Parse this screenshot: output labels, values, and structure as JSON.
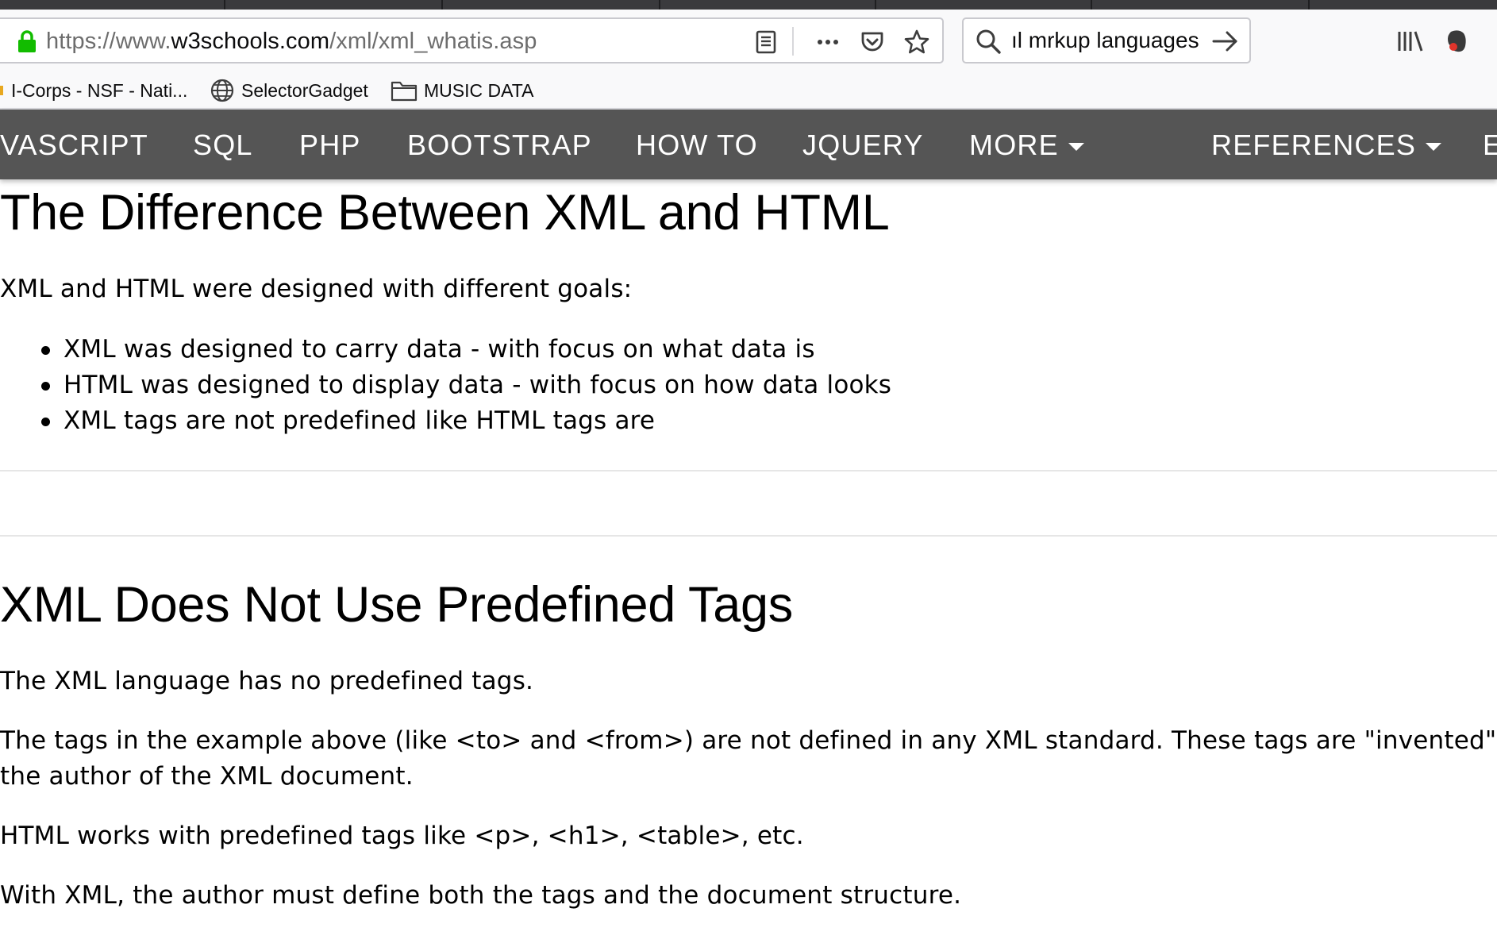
{
  "browser": {
    "url_prefix": "https://www.",
    "url_host": "w3schools.com",
    "url_path": "/xml/xml_whatis.asp",
    "search_text": "ıl mrkup languages",
    "bookmarks": [
      {
        "label": "I-Corps - NSF - Nati...",
        "icon": "bookmark-favicon"
      },
      {
        "label": "SelectorGadget",
        "icon": "globe-icon"
      },
      {
        "label": "MUSIC DATA",
        "icon": "folder-icon"
      }
    ]
  },
  "site_nav": {
    "items": [
      "VASCRIPT",
      "SQL",
      "PHP",
      "BOOTSTRAP",
      "HOW TO",
      "JQUERY",
      "MORE",
      "REFERENCES",
      "E"
    ],
    "bg_color": "#555555"
  },
  "section1": {
    "heading": "The Difference Between XML and HTML",
    "intro": "XML and HTML were designed with different goals:",
    "bullets": [
      "XML was designed to carry data - with focus on what data is",
      "HTML was designed to display data - with focus on how data looks",
      "XML tags are not predefined like HTML tags are"
    ]
  },
  "section2": {
    "heading": "XML Does Not Use Predefined Tags",
    "p1": "The XML language has no predefined tags.",
    "p2_line1": "The tags in the example above (like <to> and <from>) are not defined in any XML standard. These tags are \"invented\" by",
    "p2_line2": "the author of the XML document.",
    "p3": "HTML works with predefined tags like <p>, <h1>, <table>, etc.",
    "p4": "With XML, the author must define both the tags and the document structure."
  }
}
